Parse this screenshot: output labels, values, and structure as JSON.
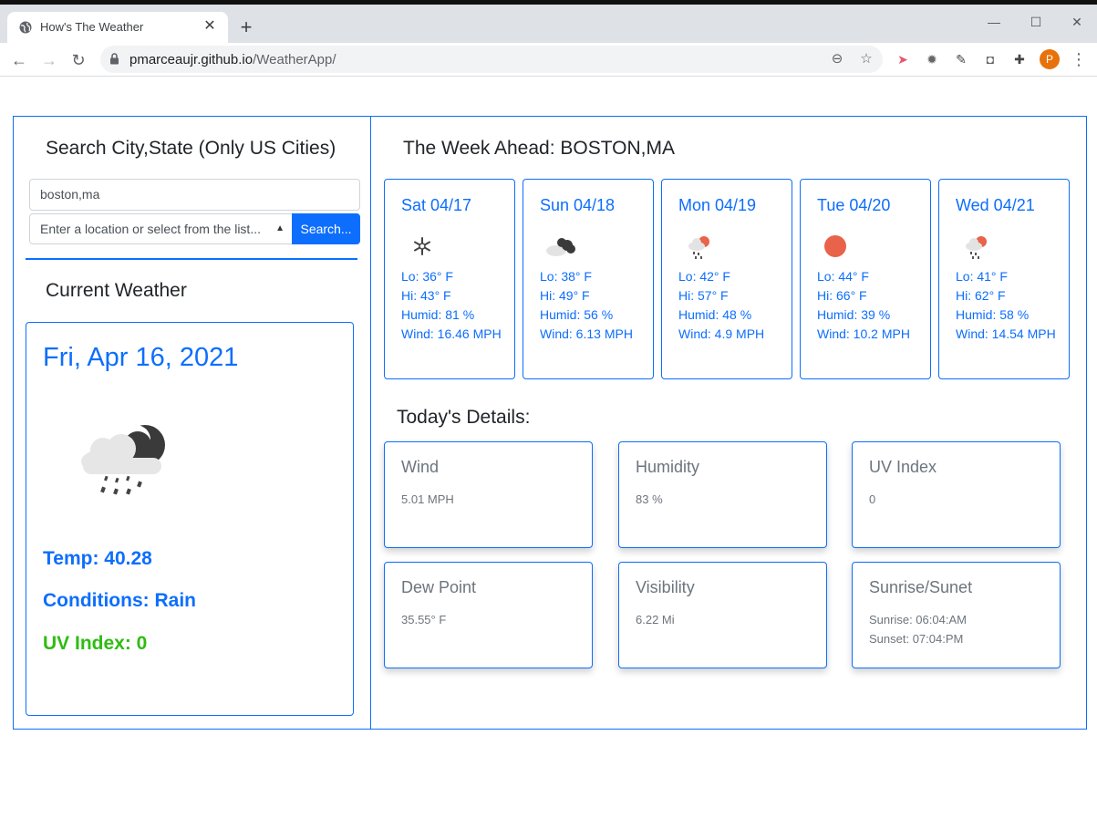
{
  "browser": {
    "tab_title": "How's The Weather",
    "url_host": "pmarceaujr.github.io",
    "url_path": "/WeatherApp/",
    "profile_initial": "P"
  },
  "search": {
    "heading": "Search City,State (Only US Cities)",
    "city_value": "boston,ma",
    "select_placeholder": "Enter a location or select from the list...",
    "button_label": "Search..."
  },
  "current": {
    "heading": "Current Weather",
    "date": "Fri, Apr 16, 2021",
    "icon": "rain-night-icon",
    "temp": "Temp: 40.28",
    "conditions": "Conditions: Rain",
    "uv": "UV Index: 0"
  },
  "week": {
    "heading": "The Week Ahead: BOSTON,MA",
    "days": [
      {
        "title": "Sat 04/17",
        "icon": "snow-icon",
        "lo": "Lo: 36° F",
        "hi": "Hi: 43° F",
        "humid": "Humid: 81 %",
        "wind": "Wind: 16.46 MPH"
      },
      {
        "title": "Sun 04/18",
        "icon": "cloudy-icon",
        "lo": "Lo: 38° F",
        "hi": "Hi: 49° F",
        "humid": "Humid: 56 %",
        "wind": "Wind: 6.13 MPH"
      },
      {
        "title": "Mon 04/19",
        "icon": "rain-sun-icon",
        "lo": "Lo: 42° F",
        "hi": "Hi: 57° F",
        "humid": "Humid: 48 %",
        "wind": "Wind: 4.9 MPH"
      },
      {
        "title": "Tue 04/20",
        "icon": "sun-icon",
        "lo": "Lo: 44° F",
        "hi": "Hi: 66° F",
        "humid": "Humid: 39 %",
        "wind": "Wind: 10.2 MPH"
      },
      {
        "title": "Wed 04/21",
        "icon": "rain-sun-icon",
        "lo": "Lo: 41° F",
        "hi": "Hi: 62° F",
        "humid": "Humid: 58 %",
        "wind": "Wind: 14.54 MPH"
      }
    ]
  },
  "details": {
    "heading": "Today's Details:",
    "wind": {
      "title": "Wind",
      "value": "5.01 MPH"
    },
    "humidity": {
      "title": "Humidity",
      "value": "83 %"
    },
    "uv": {
      "title": "UV Index",
      "value": "0"
    },
    "dew": {
      "title": "Dew Point",
      "value": "35.55° F"
    },
    "visibility": {
      "title": "Visibility",
      "value": "6.22 Mi"
    },
    "sun": {
      "title": "Sunrise/Sunet",
      "sunrise": "Sunrise: 06:04:AM",
      "sunset": "Sunset: 07:04:PM"
    }
  },
  "colors": {
    "accent": "#0d6efd",
    "uv_good": "#2ebd12",
    "sun": "#e8634a"
  }
}
